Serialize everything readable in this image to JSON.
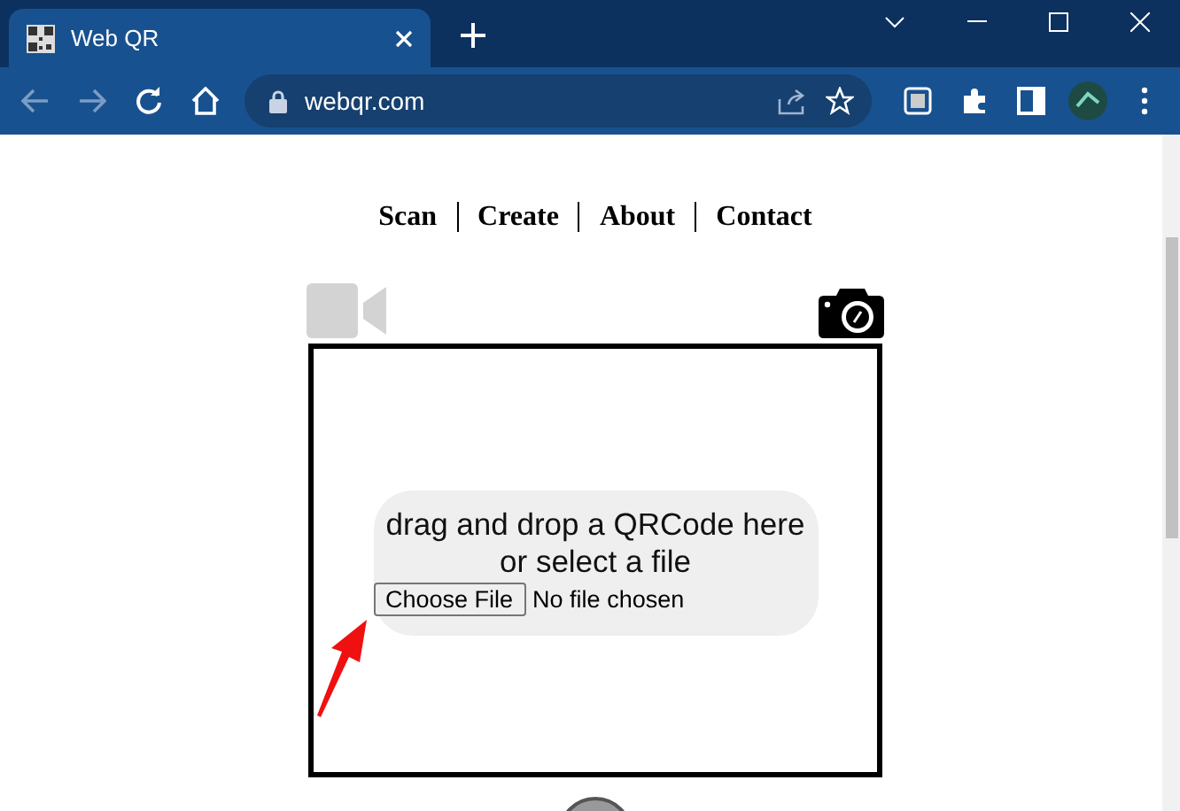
{
  "browser": {
    "tab": {
      "title": "Web QR"
    },
    "address": "webqr.com"
  },
  "nav": [
    {
      "label": "Scan"
    },
    {
      "label": "Create"
    },
    {
      "label": "About"
    },
    {
      "label": "Contact"
    }
  ],
  "drop_zone": {
    "prompt": "drag and drop a QRCode here\nor select a file",
    "button": "Choose File",
    "file_status": "No file chosen"
  }
}
